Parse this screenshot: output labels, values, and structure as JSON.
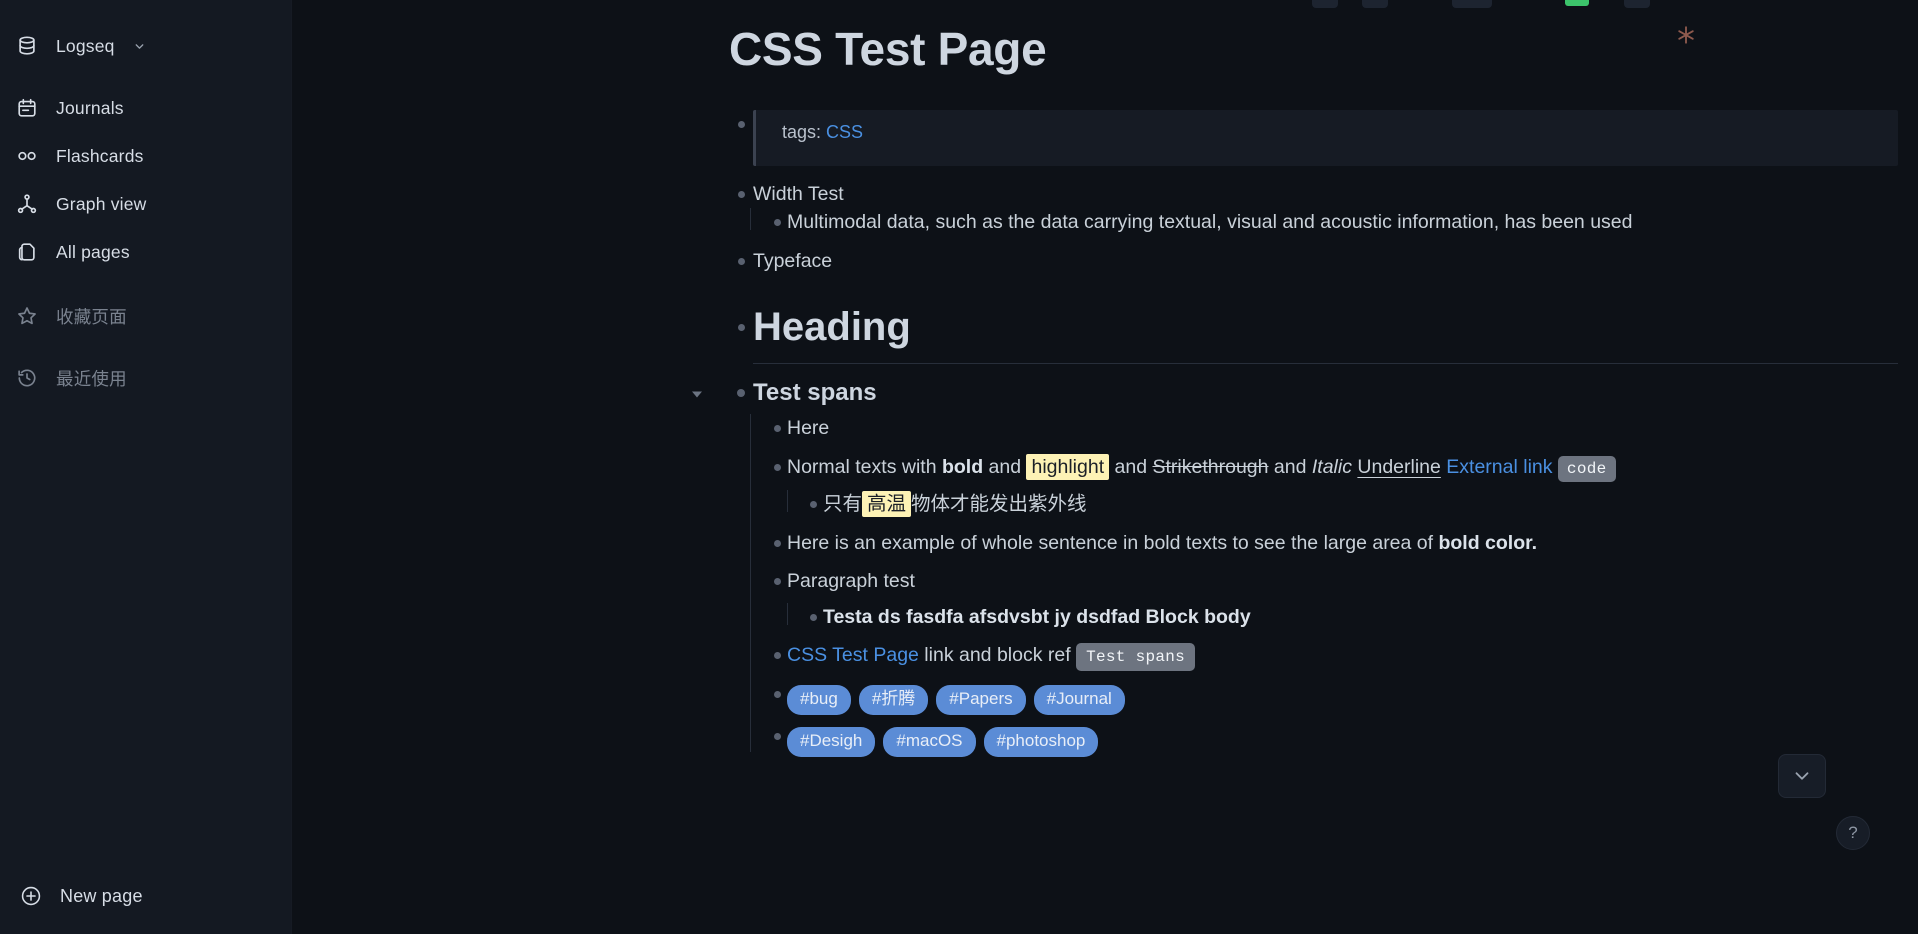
{
  "sidebar": {
    "graph": {
      "label": "Logseq",
      "icon": "database-icon",
      "caret": "chevron-down-icon"
    },
    "nav": [
      {
        "label": "Journals",
        "icon": "calendar-icon"
      },
      {
        "label": "Flashcards",
        "icon": "infinity-icon"
      },
      {
        "label": "Graph view",
        "icon": "graph-icon"
      },
      {
        "label": "All pages",
        "icon": "pages-icon"
      }
    ],
    "sections": [
      {
        "label": "收藏页面",
        "icon": "star-icon"
      },
      {
        "label": "最近使用",
        "icon": "history-icon"
      }
    ],
    "new_page": {
      "label": "New page",
      "icon": "plus-circle-icon"
    }
  },
  "topbar": {
    "asterisk_icon": "asterisk-icon"
  },
  "page": {
    "title": "CSS Test Page",
    "properties": {
      "key": "tags:",
      "value": "CSS"
    },
    "blocks": {
      "width_test": "Width Test",
      "width_test_child": "Multimodal data, such as the data carrying textual, visual and acoustic information, has been used",
      "typeface": "Typeface",
      "heading": "Heading",
      "test_spans": "Test spans",
      "here": "Here",
      "spans_line": {
        "p1": "Normal texts with ",
        "bold": "bold",
        "p2": " and ",
        "highlight": "highlight",
        "p3": " and ",
        "strike": "Strikethrough",
        "p4": " and ",
        "italic": "Italic",
        "p5": " ",
        "underline": "Underline",
        "p6": " ",
        "link": "External link",
        "p7": " ",
        "code": "code"
      },
      "chinese_line": {
        "p1": "只有",
        "highlight": "高温",
        "p2": "物体才能发出紫外线"
      },
      "bold_sentence": {
        "p1": "Here is an example of whole sentence in bold texts to see the large area of ",
        "bold": "bold color."
      },
      "paragraph_test": "Paragraph test",
      "paragraph_child": "Testa ds fasdfa afsdvsbt jy dsdfad Block body",
      "ref_line": {
        "link": "CSS Test Page",
        "mid": " link and block ref ",
        "blockref": "Test spans"
      },
      "tags_row_1": [
        "#bug",
        "#折腾",
        "#Papers",
        "#Journal"
      ],
      "tags_row_2": [
        "#Desigh",
        "#macOS",
        "#photoshop"
      ]
    }
  },
  "floating": {
    "scroll_down_icon": "chevron-down-icon",
    "help_label": "?"
  },
  "colors": {
    "background": "#0d1117",
    "sidebar": "#141922",
    "link": "#4a90e2",
    "highlight": "#fdf2b5",
    "tag": "#5b8cd6",
    "code_bg": "#6d7480"
  }
}
